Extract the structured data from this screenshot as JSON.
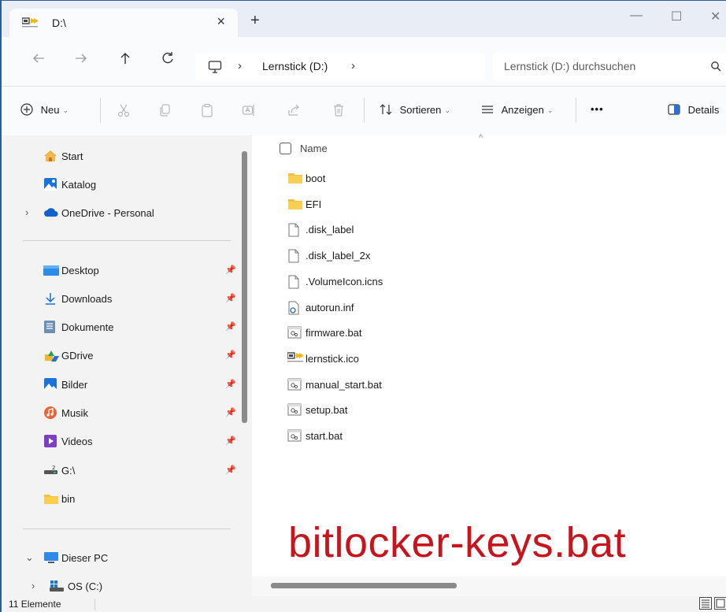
{
  "window": {
    "tab_title": "D:\\",
    "tab_close": "×",
    "new_tab": "+",
    "minimize": "—",
    "maximize": "☐",
    "close": "✕"
  },
  "addressbar": {
    "root_separator": "›",
    "breadcrumb": "Lernstick (D:)",
    "trailing_separator": "›",
    "search_placeholder": "Lernstick (D:) durchsuchen"
  },
  "toolbar": {
    "new_label": "Neu",
    "sort_label": "Sortieren",
    "view_label": "Anzeigen",
    "more_label": "•••",
    "details_label": "Details"
  },
  "sidebar": {
    "top_items": [
      {
        "label": "Start",
        "icon": "home-icon"
      },
      {
        "label": "Katalog",
        "icon": "gallery-icon"
      },
      {
        "label": "OneDrive - Personal",
        "icon": "cloud-icon"
      }
    ],
    "quick_access": [
      {
        "label": "Desktop",
        "icon": "desktop-icon",
        "pinned": true
      },
      {
        "label": "Downloads",
        "icon": "download-icon",
        "pinned": true
      },
      {
        "label": "Dokumente",
        "icon": "document-icon",
        "pinned": true
      },
      {
        "label": "GDrive",
        "icon": "gdrive-icon",
        "pinned": true
      },
      {
        "label": "Bilder",
        "icon": "pictures-icon",
        "pinned": true
      },
      {
        "label": "Musik",
        "icon": "music-icon",
        "pinned": true
      },
      {
        "label": "Videos",
        "icon": "videos-icon",
        "pinned": true
      },
      {
        "label": "G:\\",
        "icon": "drive-icon",
        "pinned": true
      },
      {
        "label": "bin",
        "icon": "folder-icon",
        "pinned": false
      }
    ],
    "this_pc": {
      "label": "Dieser PC",
      "icon": "pc-icon"
    },
    "os_drive": {
      "label": "OS (C:)",
      "icon": "windows-drive-icon"
    }
  },
  "content": {
    "column_name": "Name",
    "files": [
      {
        "name": "boot",
        "type": "folder"
      },
      {
        "name": "EFI",
        "type": "folder"
      },
      {
        "name": ".disk_label",
        "type": "file"
      },
      {
        "name": ".disk_label_2x",
        "type": "file"
      },
      {
        "name": ".VolumeIcon.icns",
        "type": "file"
      },
      {
        "name": "autorun.inf",
        "type": "config"
      },
      {
        "name": "firmware.bat",
        "type": "batch"
      },
      {
        "name": "lernstick.ico",
        "type": "lernstick"
      },
      {
        "name": "manual_start.bat",
        "type": "batch"
      },
      {
        "name": "setup.bat",
        "type": "batch"
      },
      {
        "name": "start.bat",
        "type": "batch"
      }
    ],
    "overlay_text": "bitlocker-keys.bat"
  },
  "status": {
    "item_count": "11 Elemente"
  },
  "colors": {
    "accent": "#2b5d9c",
    "folder": "#f3c13a",
    "overlay_red": "#c8141c",
    "lernstick_yellow": "#f5b800"
  }
}
